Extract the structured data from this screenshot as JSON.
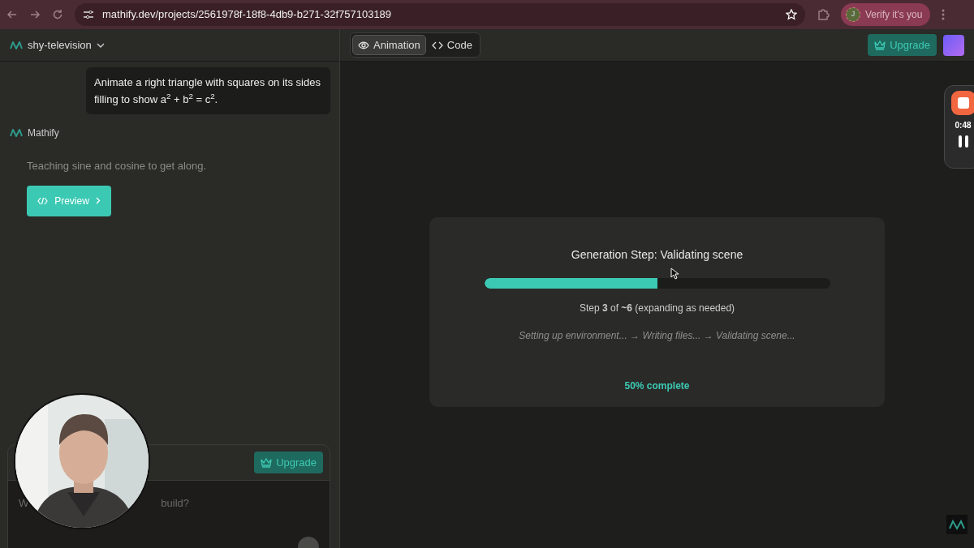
{
  "browser": {
    "url": "mathify.dev/projects/2561978f-18f8-4db9-b271-32f757103189",
    "profile_label": "Verify it's you",
    "profile_initial": "J"
  },
  "project": {
    "name": "shy-television"
  },
  "view_tabs": [
    {
      "label": "Animation",
      "selected": true
    },
    {
      "label": "Code",
      "selected": false
    }
  ],
  "header": {
    "upgrade_label": "Upgrade"
  },
  "chat": [
    {
      "kind": "user",
      "text": "Animate a right triangle with squares on its sides filling to show a$^{2}$ + b$^{2}$ = c$^{2}$."
    },
    {
      "kind": "assistant",
      "author": "Mathify",
      "text": "Teaching sine and cosine to get along.",
      "button": "Preview"
    }
  ],
  "composer": {
    "upgrade_label": "Upgrade",
    "placeholder_start": "W",
    "placeholder_end": "build?"
  },
  "progress": {
    "title": "Generation Step: Validating scene",
    "level": 0.5,
    "step": "Step **3** of **~6** (expanding as needed)",
    "trail": "Setting up environment... → Writing files... → Validating scene...",
    "percent": "50% complete"
  },
  "recorder": {
    "time": "0:48"
  }
}
